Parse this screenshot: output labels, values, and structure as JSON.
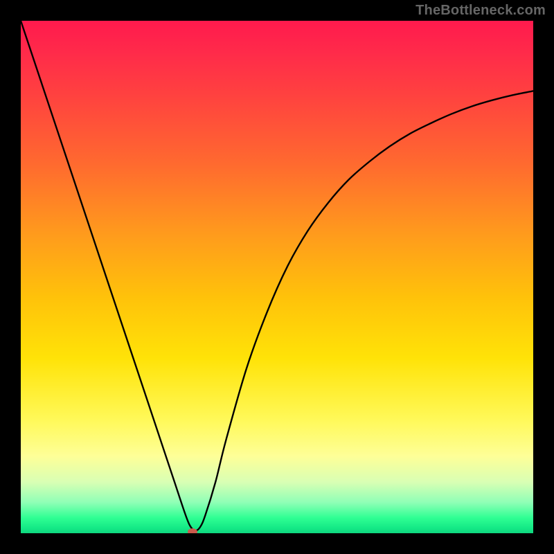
{
  "watermark": "TheBottleneck.com",
  "chart_data": {
    "type": "line",
    "title": "",
    "xlabel": "",
    "ylabel": "",
    "xlim": [
      0,
      100
    ],
    "ylim": [
      0,
      100
    ],
    "series": [
      {
        "name": "curve",
        "x": [
          0,
          4,
          8,
          12,
          16,
          20,
          24,
          28,
          30,
          32,
          33,
          34,
          35,
          36,
          38,
          40,
          44,
          48,
          52,
          56,
          60,
          64,
          68,
          72,
          76,
          80,
          84,
          88,
          92,
          96,
          100
        ],
        "values": [
          100,
          88,
          76,
          64,
          52,
          40,
          28,
          16,
          10,
          4,
          1.5,
          0.5,
          1.2,
          3.5,
          10,
          18,
          32,
          43,
          52,
          59,
          64.5,
          69,
          72.5,
          75.5,
          78,
          80,
          81.8,
          83.3,
          84.5,
          85.5,
          86.3
        ]
      }
    ],
    "marker": {
      "x": 33.5,
      "y": 0.3
    },
    "grid": false,
    "legend": false
  }
}
